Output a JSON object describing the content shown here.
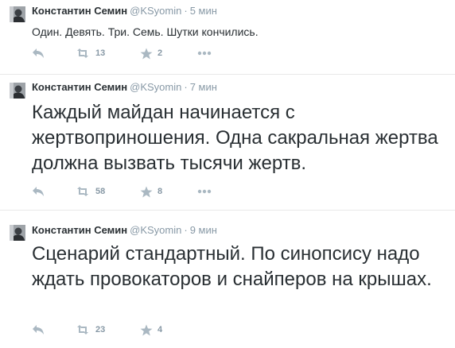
{
  "tweets": [
    {
      "author": {
        "fullname": "Константин Семин",
        "username": "@KSyomin"
      },
      "separator": "·",
      "time": "5 мин",
      "text": "Один. Девять. Три. Семь. Шутки кончились.",
      "retweets": "13",
      "favorites": "2"
    },
    {
      "author": {
        "fullname": "Константин Семин",
        "username": "@KSyomin"
      },
      "separator": "·",
      "time": "7 мин",
      "text": "Каждый майдан начинается с жертвоприношения. Одна сакральная жертва должна вызвать тысячи жертв.",
      "retweets": "58",
      "favorites": "8"
    },
    {
      "author": {
        "fullname": "Константин Семин",
        "username": "@KSyomin"
      },
      "separator": "·",
      "time": "9 мин",
      "text": "Сценарий стандартный. По синопсису надо ждать провокаторов и снайперов на крышах.",
      "retweets": "23",
      "favorites": "4"
    }
  ],
  "icons": {
    "reply": "reply-icon",
    "retweet": "retweet-icon",
    "favorite": "star-icon",
    "more": "more-icon"
  },
  "colors": {
    "text": "#292f33",
    "muted": "#8899a6",
    "icon": "#aab8c2",
    "divider": "#e8e8e8"
  }
}
